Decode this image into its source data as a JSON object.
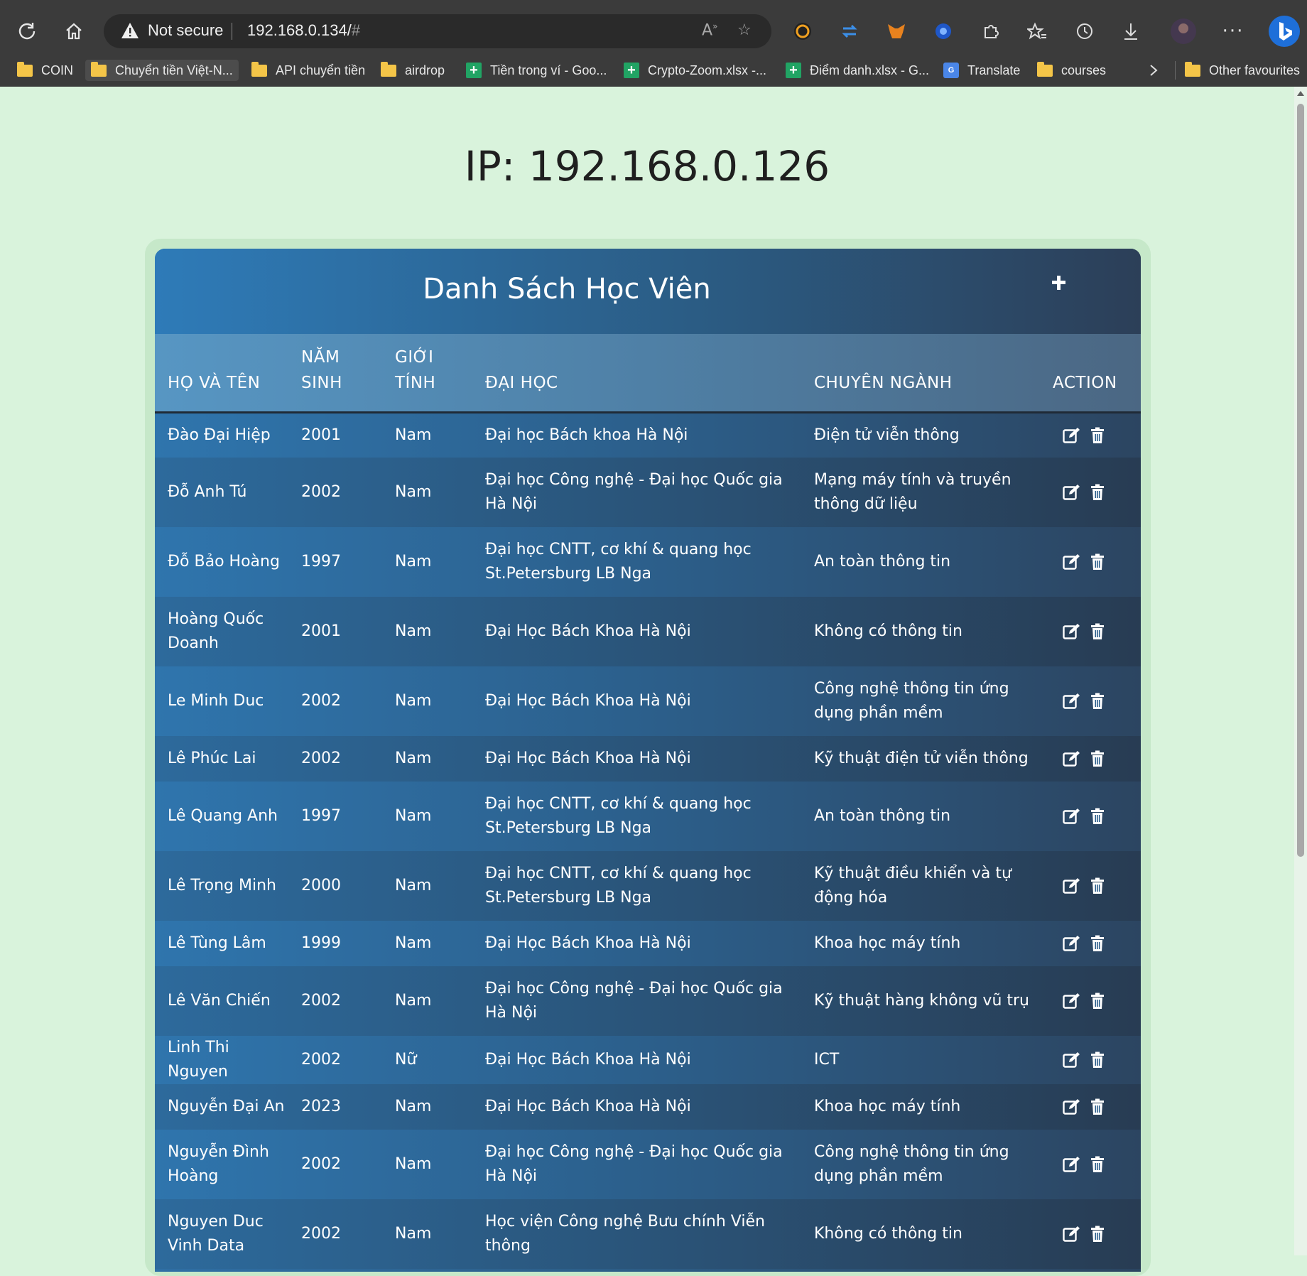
{
  "browser": {
    "security_label": "Not secure",
    "url_main": "192.168.0.134/",
    "url_hash": "#",
    "bookmarks": [
      {
        "label": "COIN",
        "icon": "folder-icon"
      },
      {
        "label": "Chuyển tiền Việt-N...",
        "icon": "folder-icon"
      },
      {
        "label": "API chuyển tiền",
        "icon": "folder-icon"
      },
      {
        "label": "airdrop",
        "icon": "folder-icon"
      },
      {
        "label": "Tiền trong ví - Goo...",
        "icon": "sheets-icon"
      },
      {
        "label": "Crypto-Zoom.xlsx -...",
        "icon": "sheets-icon"
      },
      {
        "label": "Điểm danh.xlsx - G...",
        "icon": "sheets-icon"
      },
      {
        "label": "Translate",
        "icon": "translate-icon"
      },
      {
        "label": "courses",
        "icon": "folder-icon"
      }
    ],
    "other_favourites": "Other favourites"
  },
  "page": {
    "ip_title": "IP: 192.168.0.126",
    "card_title": "Danh Sách Học Viên"
  },
  "table": {
    "headers": [
      "HỌ VÀ TÊN",
      "NĂM SINH",
      "GIỚI TÍNH",
      "ĐẠI HỌC",
      "CHUYÊN NGÀNH",
      "ACTION"
    ],
    "rows": [
      {
        "name": "Đào Đại Hiệp",
        "year": "2001",
        "gender": "Nam",
        "university": "Đại học Bách khoa Hà Nội",
        "major": "Điện tử viễn thông"
      },
      {
        "name": "Đỗ Anh Tú",
        "year": "2002",
        "gender": "Nam",
        "university": "Đại học Công nghệ - Đại học Quốc gia Hà Nội",
        "major": "Mạng máy tính và truyền thông dữ liệu"
      },
      {
        "name": "Đỗ Bảo Hoàng",
        "year": "1997",
        "gender": "Nam",
        "university": "Đại học CNTT, cơ khí & quang học St.Petersburg LB Nga",
        "major": "An toàn thông tin"
      },
      {
        "name": "Hoàng Quốc Doanh",
        "year": "2001",
        "gender": "Nam",
        "university": "Đại Học Bách Khoa Hà Nội",
        "major": "Không có thông tin"
      },
      {
        "name": "Le Minh Duc",
        "year": "2002",
        "gender": "Nam",
        "university": "Đại Học Bách Khoa Hà Nội",
        "major": "Công nghệ thông tin ứng dụng phần mềm"
      },
      {
        "name": "Lê Phúc Lai",
        "year": "2002",
        "gender": "Nam",
        "university": "Đại Học Bách Khoa Hà Nội",
        "major": "Kỹ thuật điện tử viễn thông"
      },
      {
        "name": "Lê Quang Anh",
        "year": "1997",
        "gender": "Nam",
        "university": "Đại học CNTT, cơ khí & quang học St.Petersburg LB Nga",
        "major": "An toàn thông tin"
      },
      {
        "name": "Lê Trọng Minh",
        "year": "2000",
        "gender": "Nam",
        "university": "Đại học CNTT, cơ khí & quang học St.Petersburg LB Nga",
        "major": "Kỹ thuật điều khiển và tự động hóa"
      },
      {
        "name": "Lê Tùng Lâm",
        "year": "1999",
        "gender": "Nam",
        "university": "Đại Học Bách Khoa Hà Nội",
        "major": "Khoa học máy tính"
      },
      {
        "name": "Lê Văn Chiến",
        "year": "2002",
        "gender": "Nam",
        "university": "Đại học Công nghệ - Đại học Quốc gia Hà Nội",
        "major": "Kỹ thuật hàng không vũ trụ"
      },
      {
        "name": "Linh Thi Nguyen",
        "year": "2002",
        "gender": "Nữ",
        "university": "Đại Học Bách Khoa Hà Nội",
        "major": "ICT"
      },
      {
        "name": "Nguyễn Đại An",
        "year": "2023",
        "gender": "Nam",
        "university": "Đại Học Bách Khoa Hà Nội",
        "major": "Khoa học máy tính"
      },
      {
        "name": "Nguyễn Đình Hoàng",
        "year": "2002",
        "gender": "Nam",
        "university": "Đại học Công nghệ - Đại học Quốc gia Hà Nội",
        "major": "Công nghệ thông tin ứng dụng phần mềm"
      },
      {
        "name": "Nguyen Duc Vinh Data",
        "year": "2002",
        "gender": "Nam",
        "university": "Học viện Công nghệ Bưu chính Viễn thông",
        "major": "Không có thông tin"
      }
    ]
  },
  "colors": {
    "page_bg": "#d9f3dc",
    "header_start": "#2e7bb8",
    "header_end": "#2c3f58"
  }
}
